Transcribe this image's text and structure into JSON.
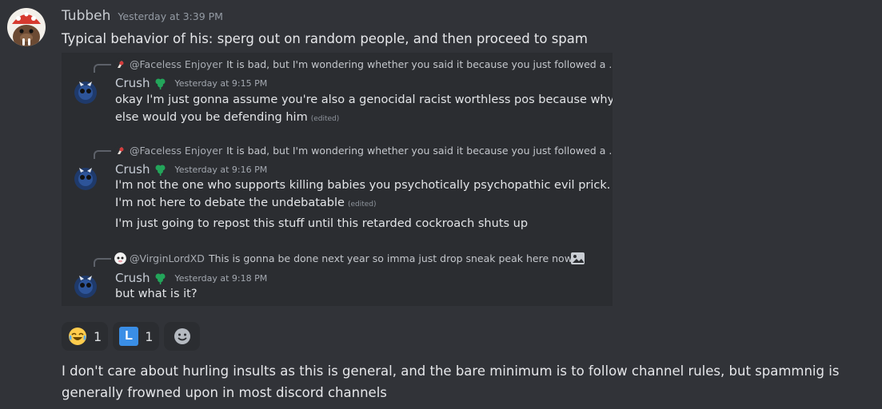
{
  "message": {
    "username": "Tubbeh",
    "timestamp": "Yesterday at 3:39 PM",
    "text": "Typical behavior of his: sperg out on random people, and then proceed to spam"
  },
  "quoted": [
    {
      "reply_user": "@Faceless Enjoyer",
      "reply_text": "It is bad, but I'm wondering whether you said it because you just followed a ...",
      "author": "Crush",
      "time": "Yesterday at 9:15 PM",
      "lines": [
        "okay I'm just gonna assume you're also a genocidal racist worthless pos because why",
        "else would you be defending him"
      ],
      "edited": "(edited)"
    },
    {
      "reply_user": "@Faceless Enjoyer",
      "reply_text": "It is bad, but I'm wondering whether you said it because you just followed a ...",
      "author": "Crush",
      "time": "Yesterday at 9:16 PM",
      "lines": [
        "I'm not the one who supports killing babies you psychotically psychopathic evil prick.",
        "I'm not here to debate the undebatable",
        "I'm just going to repost this stuff until this retarded cockroach shuts up"
      ],
      "edited": "(edited)"
    },
    {
      "reply_user": "@VirginLordXD",
      "reply_text": "This is gonna be done next year so imma just drop sneak peak here now ...",
      "author": "Crush",
      "time": "Yesterday at 9:18 PM",
      "lines": [
        "but what is it?"
      ]
    }
  ],
  "reactions": [
    {
      "icon": "joy-emoji-icon",
      "count": "1"
    },
    {
      "icon": "l-letter-icon",
      "label": "L",
      "count": "1"
    }
  ],
  "followup": {
    "line1": "I don't care about hurling insults as this is general, and the bare minimum is to follow channel rules, but spammnig is",
    "line2": "generally frowned upon in most discord channels"
  },
  "colors": {
    "background": "#313338",
    "embed_background": "#2b2d31",
    "badge_green": "#23a55a",
    "l_blue": "#3a8ee6"
  }
}
